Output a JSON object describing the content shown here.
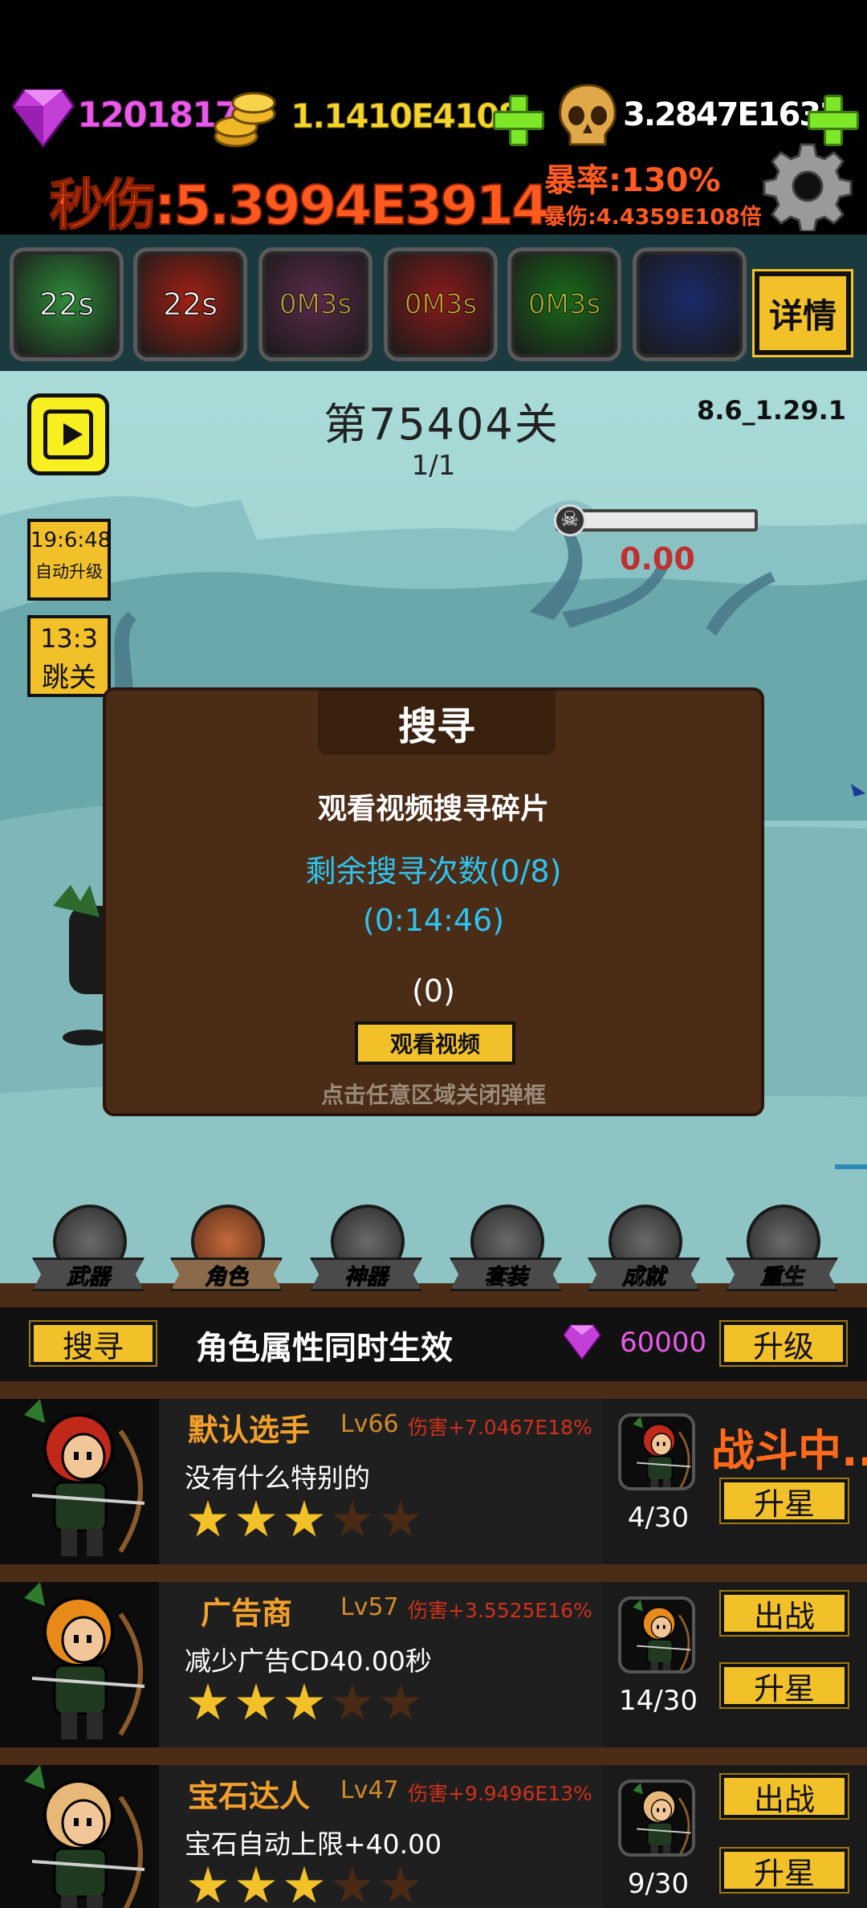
{
  "hud": {
    "gems": "1201817",
    "gold": "1.1410E4108",
    "souls": "3.2847E1632",
    "dps": "秒伤:5.3994E3914",
    "crit_rate": "暴率:130%",
    "crit_damage": "暴伤:4.4359E108倍"
  },
  "skills": [
    {
      "label": "22s",
      "icon": "double-arrow-skill-icon",
      "color": "#2e8a3a"
    },
    {
      "label": "22s",
      "icon": "fire-arrow-skill-icon",
      "color": "#a02014"
    },
    {
      "label": "0M3s",
      "icon": "golden-stars-skill-icon",
      "color": "#5a2a4a"
    },
    {
      "label": "0M3s",
      "icon": "red-archer-skill-icon",
      "color": "#8a1a1a"
    },
    {
      "label": "0M3s",
      "icon": "green-bow-skill-icon",
      "color": "#1a6a1a"
    },
    {
      "label": "",
      "icon": "clock-skill-icon",
      "color": "#1a2a6a"
    }
  ],
  "detail_button": "详情",
  "scene": {
    "stage": "第75404关",
    "wave": "1/1",
    "version": "8.6_1.29.1",
    "boss_hp_text": "0.00",
    "boss_hp_fraction": 0,
    "auto_timer": "19:6:48",
    "auto_label": "自动升级",
    "skip_timer": "13:3",
    "skip_label": "跳关"
  },
  "dialog": {
    "title": "搜寻",
    "line1": "观看视频搜寻碎片",
    "remaining": "剩余搜寻次数(0/8)",
    "countdown": "(0:14:46)",
    "count": "(0)",
    "watch_button": "观看视频",
    "close_hint": "点击任意区域关闭弹框"
  },
  "tabs": [
    {
      "label": "武器",
      "icon": "axe-icon"
    },
    {
      "label": "角色",
      "icon": "archer-icon"
    },
    {
      "label": "神器",
      "icon": "gauntlet-icon"
    },
    {
      "label": "套装",
      "icon": "helmet-icon"
    },
    {
      "label": "成就",
      "icon": "book-icon"
    },
    {
      "label": "重生",
      "icon": "flame-icon"
    }
  ],
  "panel": {
    "search_button": "搜寻",
    "hint": "角色属性同时生效",
    "gem_cost": "60000",
    "upgrade_button": "升级"
  },
  "characters": [
    {
      "name": "默认选手",
      "level": "Lv66",
      "damage": "伤害+7.0467E18%",
      "desc": "没有什么特别的",
      "stars": 3,
      "fragments": "4/30",
      "status": "战斗中..",
      "deploy": "",
      "star_button": "升星",
      "hood": "#c0281a"
    },
    {
      "name": "广告商",
      "level": "Lv57",
      "damage": "伤害+3.5525E16%",
      "desc": "减少广告CD40.00秒",
      "stars": 3,
      "fragments": "14/30",
      "status": "",
      "deploy": "出战",
      "star_button": "升星",
      "hood": "#e88a1a"
    },
    {
      "name": "宝石达人",
      "level": "Lv47",
      "damage": "伤害+9.9496E13%",
      "desc": "宝石自动上限+40.00",
      "stars": 3,
      "fragments": "9/30",
      "status": "",
      "deploy": "出战",
      "star_button": "升星",
      "hood": "#e8b878"
    }
  ]
}
